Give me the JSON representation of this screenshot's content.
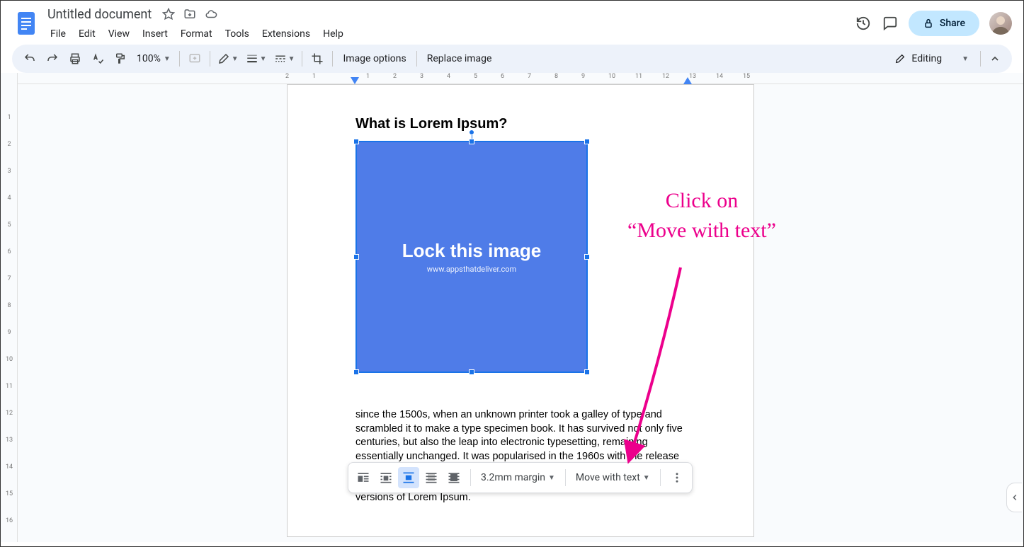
{
  "header": {
    "doc_title": "Untitled document",
    "menus": [
      "File",
      "Edit",
      "View",
      "Insert",
      "Format",
      "Tools",
      "Extensions",
      "Help"
    ],
    "share_label": "Share"
  },
  "toolbar": {
    "zoom": "100%",
    "image_options": "Image options",
    "replace_image": "Replace image",
    "editing_label": "Editing"
  },
  "document": {
    "heading": "What is Lorem Ipsum?",
    "image_main_text": "Lock this image",
    "image_sub_text": "www.appsthatdeliver.com",
    "body_text": "since the 1500s, when an unknown printer took a galley of type and scrambled it to make a type specimen book. It has survived not only five centuries, but also the leap into electronic typesetting, remaining essentially unchanged. It was popularised in the 1960s with the release of Letraset sheets containing Lorem Ipsum passages, and more recently with desktop publishing software like Aldus PageMaker including versions of Lorem Ipsum."
  },
  "image_toolbar": {
    "margin_label": "3.2mm margin",
    "move_label": "Move with text"
  },
  "annotation": {
    "line1": "Click on",
    "line2": "“Move with text”"
  },
  "ruler_h": [
    "2",
    "1",
    "",
    "1",
    "2",
    "3",
    "4",
    "5",
    "6",
    "7",
    "8",
    "9",
    "10",
    "11",
    "12",
    "13",
    "14",
    "15"
  ],
  "ruler_v": [
    "",
    "1",
    "2",
    "3",
    "4",
    "5",
    "6",
    "7",
    "8",
    "9",
    "10",
    "11",
    "12",
    "13",
    "14",
    "15",
    "16"
  ]
}
